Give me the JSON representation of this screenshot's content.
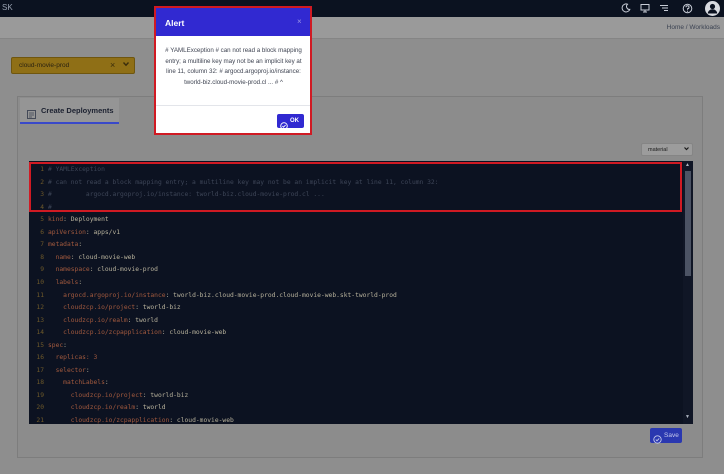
{
  "topbar": {
    "brand": "SK",
    "icons": [
      "moon-icon",
      "monitor-icon",
      "list-icon",
      "help-icon",
      "user-icon"
    ]
  },
  "breadcrumb": "Home / Workloads",
  "namespace_select": {
    "value": "cloud-movie-prod",
    "clear_icon": "close-icon",
    "chevron_icon": "chevron-down-icon"
  },
  "tab": {
    "label": "Create Deployments",
    "icon": "form-icon"
  },
  "mode_select": {
    "value": "material"
  },
  "editor": {
    "lines": [
      {
        "n": "1",
        "parts": [
          {
            "t": "# YAMLException",
            "c": "comment"
          }
        ]
      },
      {
        "n": "2",
        "parts": [
          {
            "t": "# can not read a block mapping entry; a multiline key may not be an implicit key at line 11, column 32:",
            "c": "comment"
          }
        ]
      },
      {
        "n": "3",
        "parts": [
          {
            "t": "#         argocd.argoproj.io/instance: tworld-biz.cloud-movie-prod.cl ...",
            "c": "comment"
          }
        ]
      },
      {
        "n": "4",
        "parts": [
          {
            "t": "#",
            "c": "comment"
          }
        ]
      },
      {
        "n": "5",
        "parts": [
          {
            "t": "kind",
            "c": "key"
          },
          {
            "t": ": Deployment",
            "c": "val"
          }
        ]
      },
      {
        "n": "6",
        "parts": [
          {
            "t": "apiVersion",
            "c": "key"
          },
          {
            "t": ": apps/v1",
            "c": "val"
          }
        ]
      },
      {
        "n": "7",
        "parts": [
          {
            "t": "metadata",
            "c": "key"
          },
          {
            "t": ":",
            "c": "val"
          }
        ]
      },
      {
        "n": "8",
        "parts": [
          {
            "t": "  name",
            "c": "key"
          },
          {
            "t": ": cloud-movie-web",
            "c": "val"
          }
        ]
      },
      {
        "n": "9",
        "parts": [
          {
            "t": "  namespace",
            "c": "key"
          },
          {
            "t": ": cloud-movie-prod",
            "c": "val"
          }
        ]
      },
      {
        "n": "10",
        "parts": [
          {
            "t": "  labels",
            "c": "key"
          },
          {
            "t": ":",
            "c": "val"
          }
        ]
      },
      {
        "n": "11",
        "parts": [
          {
            "t": "    argocd.argoproj.io/instance",
            "c": "key"
          },
          {
            "t": ": tworld-biz.cloud-movie-prod.cloud-movie-web.skt-tworld-prod",
            "c": "val"
          }
        ]
      },
      {
        "n": "12",
        "parts": [
          {
            "t": "    cloudzcp.io/project",
            "c": "key"
          },
          {
            "t": ": tworld-biz",
            "c": "val"
          }
        ]
      },
      {
        "n": "13",
        "parts": [
          {
            "t": "    cloudzcp.io/realm",
            "c": "key"
          },
          {
            "t": ": tworld",
            "c": "val"
          }
        ]
      },
      {
        "n": "14",
        "parts": [
          {
            "t": "    cloudzcp.io/zcpapplication",
            "c": "key"
          },
          {
            "t": ": cloud-movie-web",
            "c": "val"
          }
        ]
      },
      {
        "n": "15",
        "parts": [
          {
            "t": "spec",
            "c": "key"
          },
          {
            "t": ":",
            "c": "val"
          }
        ]
      },
      {
        "n": "16",
        "parts": [
          {
            "t": "  replicas",
            "c": "key"
          },
          {
            "t": ": 3",
            "c": "key"
          }
        ]
      },
      {
        "n": "17",
        "parts": [
          {
            "t": "  selector",
            "c": "key"
          },
          {
            "t": ":",
            "c": "val"
          }
        ]
      },
      {
        "n": "18",
        "parts": [
          {
            "t": "    matchLabels",
            "c": "key"
          },
          {
            "t": ":",
            "c": "val"
          }
        ]
      },
      {
        "n": "19",
        "parts": [
          {
            "t": "      cloudzcp.io/project",
            "c": "key"
          },
          {
            "t": ": tworld-biz",
            "c": "val"
          }
        ]
      },
      {
        "n": "20",
        "parts": [
          {
            "t": "      cloudzcp.io/realm",
            "c": "key"
          },
          {
            "t": ": tworld",
            "c": "val"
          }
        ]
      },
      {
        "n": "21",
        "parts": [
          {
            "t": "      cloudzcp.io/zcpapplication",
            "c": "key"
          },
          {
            "t": ": cloud-movie-web",
            "c": "val"
          }
        ]
      }
    ]
  },
  "save_button": {
    "label": "Save",
    "icon": "check-circle-icon"
  },
  "alert": {
    "title": "Alert",
    "message": "# YAMLException # can not read a block mapping entry; a multiline key may not be an implicit key at line 11, column 32: # argocd.argoproj.io/instance: tworld-biz.cloud-movie-prod.cl ... # ^",
    "ok_label": "OK",
    "close_icon": "close-icon"
  },
  "colors": {
    "alert_header": "#3129d1",
    "error_outline": "#d01a23",
    "editor_bg": "#0c1221",
    "namespace_chip": "#8f6f16"
  }
}
